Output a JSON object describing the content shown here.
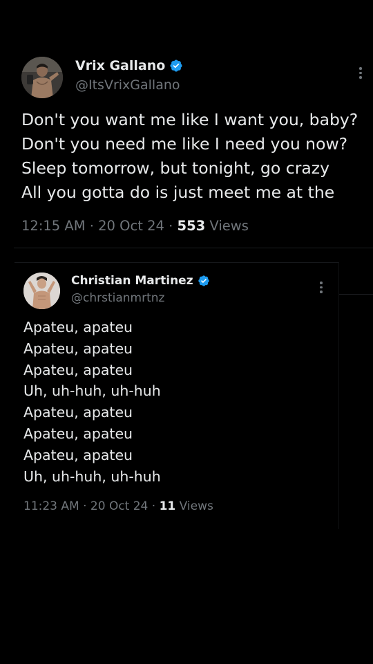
{
  "tweet1": {
    "display_name": "Vrix Gallano",
    "handle": "@ItsVrixGallano",
    "verified": true,
    "lines": [
      "Don't you want me like I want you, baby?",
      "Don't you need me like I need you now?",
      "Sleep tomorrow, but tonight, go crazy",
      "All you gotta do is just meet me at the"
    ],
    "meta_prefix": "12:15 AM · 20 Oct 24 · ",
    "views_count": "553",
    "views_suffix": " Views"
  },
  "tweet2": {
    "display_name": "Christian Martinez",
    "handle": "@chrstianmrtnz",
    "verified": true,
    "lines": [
      "Apateu, apateu",
      "Apateu, apateu",
      "Apateu, apateu",
      "Uh, uh-huh, uh-huh",
      "Apateu, apateu",
      "Apateu, apateu",
      "Apateu, apateu",
      "Uh, uh-huh, uh-huh"
    ],
    "meta_prefix": "11:23 AM · 20 Oct 24 · ",
    "views_count": "11",
    "views_suffix": " Views"
  },
  "colors": {
    "background": "#000000",
    "text_primary": "#e7e9ea",
    "text_secondary": "#71767b",
    "verified_badge": "#1d9bf0"
  },
  "icons": {
    "verified": "verified-badge-icon",
    "more": "more-options-icon"
  }
}
